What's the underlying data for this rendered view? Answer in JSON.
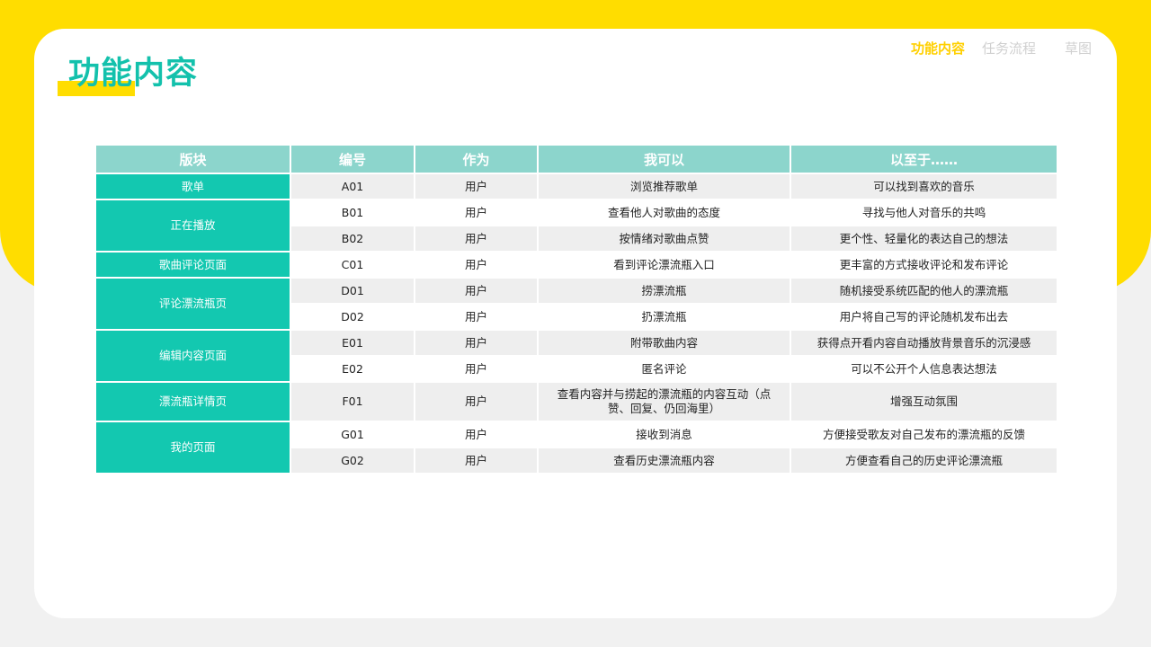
{
  "page": {
    "title": "功能内容",
    "nav": [
      "功能内容",
      "任务流程",
      "草图"
    ]
  },
  "table": {
    "headers": [
      "版块",
      "编号",
      "作为",
      "我可以",
      "以至于……"
    ],
    "blocks": [
      "歌单",
      "正在播放",
      "歌曲评论页面",
      "评论漂流瓶页",
      "编辑内容页面",
      "漂流瓶详情页",
      "我的页面"
    ],
    "rows": [
      {
        "id": "A01",
        "role": "用户",
        "action": "浏览推荐歌单",
        "goal": "可以找到喜欢的音乐"
      },
      {
        "id": "B01",
        "role": "用户",
        "action": "查看他人对歌曲的态度",
        "goal": "寻找与他人对音乐的共鸣"
      },
      {
        "id": "B02",
        "role": "用户",
        "action": "按情绪对歌曲点赞",
        "goal": "更个性、轻量化的表达自己的想法"
      },
      {
        "id": "C01",
        "role": "用户",
        "action": "看到评论漂流瓶入口",
        "goal": "更丰富的方式接收评论和发布评论"
      },
      {
        "id": "D01",
        "role": "用户",
        "action": "捞漂流瓶",
        "goal": "随机接受系统匹配的他人的漂流瓶"
      },
      {
        "id": "D02",
        "role": "用户",
        "action": "扔漂流瓶",
        "goal": "用户将自己写的评论随机发布出去"
      },
      {
        "id": "E01",
        "role": "用户",
        "action": "附带歌曲内容",
        "goal": "获得点开看内容自动播放背景音乐的沉浸感"
      },
      {
        "id": "E02",
        "role": "用户",
        "action": "匿名评论",
        "goal": "可以不公开个人信息表达想法"
      },
      {
        "id": "F01",
        "role": "用户",
        "action": "查看内容并与捞起的漂流瓶的内容互动（点赞、回复、仍回海里）",
        "goal": "增强互动氛围"
      },
      {
        "id": "G01",
        "role": "用户",
        "action": "接收到消息",
        "goal": "方便接受歌友对自己发布的漂流瓶的反馈"
      },
      {
        "id": "G02",
        "role": "用户",
        "action": "查看历史漂流瓶内容",
        "goal": "方便查看自己的历史评论漂流瓶"
      }
    ]
  }
}
